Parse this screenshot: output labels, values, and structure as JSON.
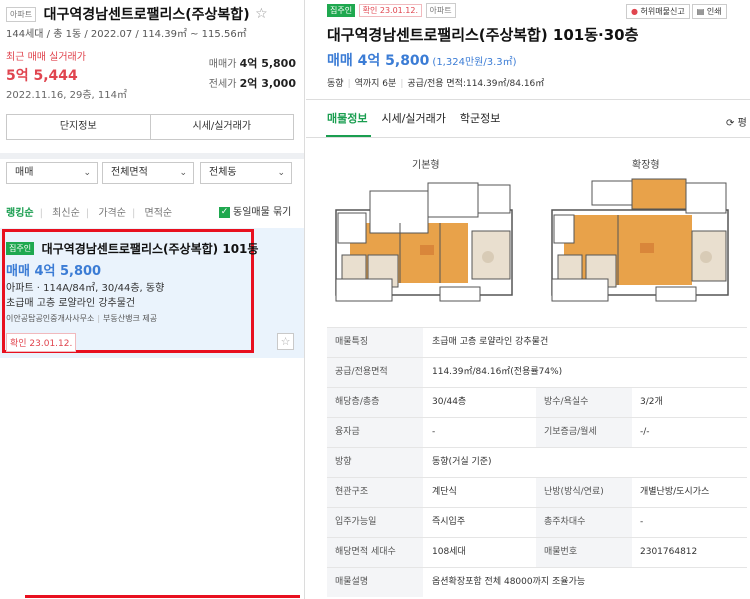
{
  "left": {
    "tag": "아파트",
    "title": "대구역경남센트로팰리스(주상복합)",
    "star": "☆",
    "sub": "144세대 / 총 1동 / 2022.07 / 114.39㎡ ~ 115.56㎡",
    "recent_label": "최근 매매 실거래가",
    "recent_price": "5억 5,444",
    "recent_date": "2022.11.16, 29층, 114㎡",
    "sale_label": "매매가",
    "sale_value": "4억 5,800",
    "jeonse_label": "전세가",
    "jeonse_value": "2억 3,000",
    "btn_info": "단지정보",
    "btn_price": "시세/실거래가",
    "filters": [
      "매매",
      "전체면적",
      "전체동"
    ],
    "sort": [
      "랭킹순",
      "최신순",
      "가격순",
      "면적순"
    ],
    "same_listing": "동일매물 묶기",
    "card": {
      "badge": "집주인",
      "title": "대구역경남센트로팰리스(주상복합) 101동",
      "price": "매매 4억 5,800",
      "spec": "아파트 · 114A/84㎡, 30/44층, 동향",
      "desc": "초급매 고층 로얄라인 강추물건",
      "agent": "이안공탑공인중개사사무소",
      "agent2": "부동산뱅크 제공",
      "confirm": "확인 23.01.12."
    }
  },
  "right": {
    "badge": "집주인",
    "confirm": "확인 23.01.12.",
    "type": "아파트",
    "report": "허위매물신고",
    "print": "인쇄",
    "title": "대구역경남센트로팰리스(주상복합) 101동·30층",
    "price": "매매 4억 5,800",
    "price_per": "(1,324만원/3.3㎡)",
    "info": [
      "동향",
      "역까지 6분",
      "공급/전용 면적:114.39㎡/84.16㎡"
    ],
    "tabs": [
      "매물정보",
      "시세/실거래가",
      "학군정보"
    ],
    "refresh": "평",
    "fp_basic": "기본형",
    "fp_ext": "확장형",
    "rows": [
      {
        "k": "매물특징",
        "v": "초급매 고층 로얄라인 강추물건"
      },
      {
        "k": "공급/전용면적",
        "v": "114.39㎡/84.16㎡(전용률74%)"
      },
      {
        "k": "해당층/총층",
        "v": "30/44층",
        "k2": "방수/욕실수",
        "v2": "3/2개"
      },
      {
        "k": "융자금",
        "v": "-",
        "k2": "기보증금/월세",
        "v2": "-/-"
      },
      {
        "k": "방향",
        "v": "동향(거실 기준)"
      },
      {
        "k": "현관구조",
        "v": "계단식",
        "k2": "난방(방식/연료)",
        "v2": "개별난방/도시가스"
      },
      {
        "k": "입주가능일",
        "v": "즉시입주",
        "k2": "총주차대수",
        "v2": "-"
      },
      {
        "k": "해당면적 세대수",
        "v": "108세대",
        "k2": "매물번호",
        "v2": "2301764812"
      },
      {
        "k": "매물설명",
        "v": "옵션확장포함 전체 48000까지 조율가능"
      }
    ]
  },
  "colors": {
    "green": "#1fa84f",
    "red": "#e0454f",
    "blue": "#3b7cd5",
    "highlight": "#e8101f"
  }
}
